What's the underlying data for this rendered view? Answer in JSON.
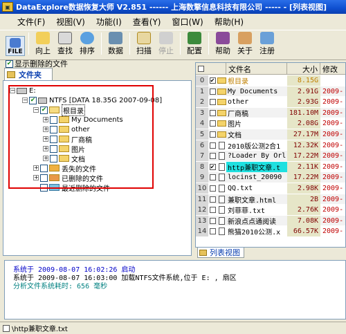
{
  "window": {
    "title": "DataExplore数据恢复大师 V2.851 ------ 上海数擎信息科技有限公司 ----- - [列表视图]"
  },
  "menu": [
    "文件(F)",
    "视图(V)",
    "功能(I)",
    "查看(Y)",
    "窗口(W)",
    "帮助(H)"
  ],
  "toolbar": [
    {
      "label": "FILE",
      "icon": "file-icon"
    },
    {
      "label": "向上",
      "icon": "up-folder-icon"
    },
    {
      "label": "查找",
      "icon": "find-icon"
    },
    {
      "label": "排序",
      "icon": "sort-icon"
    },
    {
      "label": "数据",
      "icon": "data-icon"
    },
    {
      "label": "扫描",
      "icon": "scan-icon"
    },
    {
      "label": "停止",
      "icon": "stop-icon"
    },
    {
      "label": "配置",
      "icon": "config-icon"
    },
    {
      "label": "帮助",
      "icon": "help-icon"
    },
    {
      "label": "关于",
      "icon": "about-icon"
    },
    {
      "label": "注册",
      "icon": "register-icon"
    }
  ],
  "left": {
    "show_deleted": "显示删除的文件",
    "tab_label": "文件夹",
    "tree": {
      "drive": "E:",
      "volume": "NTFS [DATA 18.35G 2007-09-08]",
      "root": "根目录",
      "children": [
        "My Documents",
        "other",
        "厂商稿",
        "图片",
        "文档"
      ],
      "lost": "丢失的文件",
      "deleted": "已删除的文件",
      "recent_deleted": "最近删除的文件"
    }
  },
  "list": {
    "headers": {
      "name": "文件名",
      "size": "大小",
      "modified": "修改"
    },
    "rows": [
      {
        "idx": "0",
        "name": "根目录",
        "size": "8.15G",
        "mod": "",
        "type": "folder",
        "checked": true
      },
      {
        "idx": "1",
        "name": "My Documents",
        "size": "2.91G",
        "mod": "2009-",
        "type": "folder",
        "checked": false
      },
      {
        "idx": "2",
        "name": "other",
        "size": "2.93G",
        "mod": "2009-",
        "type": "folder",
        "checked": false
      },
      {
        "idx": "3",
        "name": "厂商稿",
        "size": "181.10M",
        "mod": "2009-",
        "type": "folder",
        "checked": false
      },
      {
        "idx": "4",
        "name": "图片",
        "size": "2.08G",
        "mod": "2009-",
        "type": "folder",
        "checked": false
      },
      {
        "idx": "5",
        "name": "文档",
        "size": "27.17M",
        "mod": "2009-",
        "type": "folder",
        "checked": false
      },
      {
        "idx": "6",
        "name": "2010版公测2合1",
        "size": "12.32K",
        "mod": "2009-",
        "type": "doc",
        "checked": false
      },
      {
        "idx": "7",
        "name": "?Loader By Orl",
        "size": "17.22M",
        "mod": "2009-",
        "type": "doc",
        "checked": false
      },
      {
        "idx": "8",
        "name": "http兼职文章.t",
        "size": "2.11K",
        "mod": "2009-",
        "type": "doc",
        "checked": true
      },
      {
        "idx": "9",
        "name": "locinst_20090",
        "size": "17.22M",
        "mod": "2009-",
        "type": "doc",
        "checked": false
      },
      {
        "idx": "10",
        "name": "QQ.txt",
        "size": "2.98K",
        "mod": "2009-",
        "type": "doc",
        "checked": false
      },
      {
        "idx": "11",
        "name": "兼职文章.html",
        "size": "2B",
        "mod": "2009-",
        "type": "doc",
        "checked": false
      },
      {
        "idx": "12",
        "name": "刘菲菲.txt",
        "size": "2.76K",
        "mod": "2009-",
        "type": "doc",
        "checked": false
      },
      {
        "idx": "13",
        "name": "新浪点点通阅读",
        "size": "7.08K",
        "mod": "2009-",
        "type": "doc",
        "checked": false
      },
      {
        "idx": "14",
        "name": "熊猫2010公测.x",
        "size": "66.57K",
        "mod": "2009-",
        "type": "doc",
        "checked": false
      }
    ],
    "tab_label": "列表视图"
  },
  "log": [
    {
      "text": "系统于  2009-08-07 16:02:26 启动",
      "color": "blue"
    },
    {
      "text": "系统于  2009-08-07 16:03:00 加载NTFS文件系统,位于 E: ,  扇区",
      "color": "black"
    },
    {
      "text": "分析文件系统耗时: 656 毫秒",
      "color": "teal"
    }
  ],
  "status": {
    "path": "\\http兼职文章.txt"
  }
}
